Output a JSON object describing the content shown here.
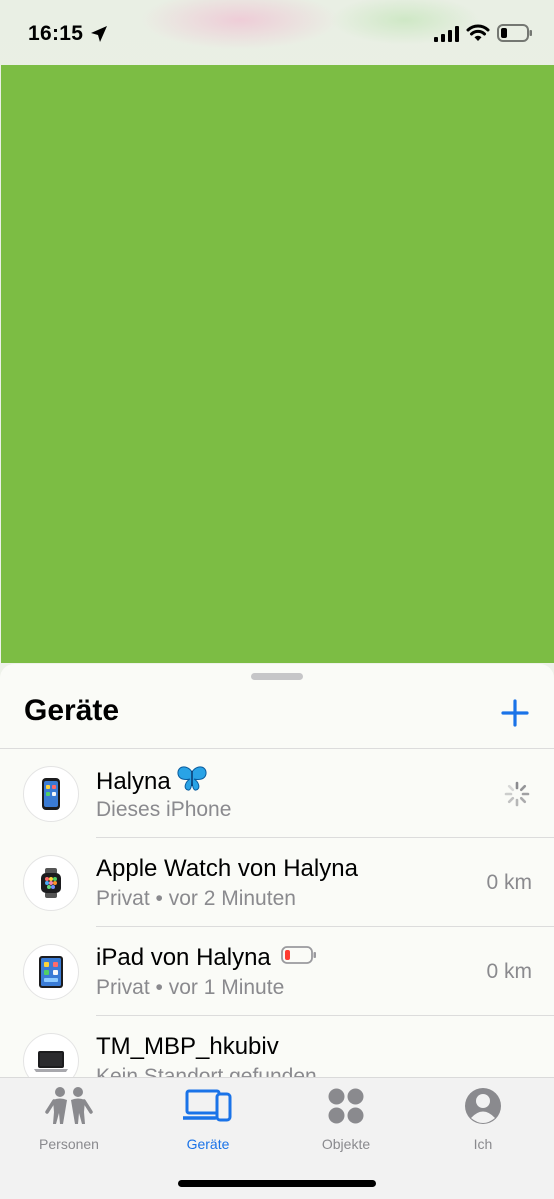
{
  "status_bar": {
    "time": "16:15"
  },
  "sheet": {
    "title": "Geräte"
  },
  "devices": [
    {
      "name": "Halyna",
      "subtitle": "Dieses iPhone",
      "distance": ""
    },
    {
      "name": "Apple Watch von Halyna",
      "subtitle": "Privat • vor 2 Minuten",
      "distance": "0 km"
    },
    {
      "name": "iPad von Halyna",
      "subtitle": "Privat • vor 1 Minute",
      "distance": "0 km"
    },
    {
      "name": "TM_MBP_hkubiv",
      "subtitle": "Kein Standort gefunden",
      "distance": ""
    }
  ],
  "tabs": [
    {
      "label": "Personen",
      "icon": "people-icon"
    },
    {
      "label": "Geräte",
      "icon": "devices-icon"
    },
    {
      "label": "Objekte",
      "icon": "items-icon"
    },
    {
      "label": "Ich",
      "icon": "person-circle-icon"
    }
  ],
  "colors": {
    "accent": "#1a73e8",
    "map_block": "#7cbd44",
    "battery_low": "#ff3b30"
  }
}
